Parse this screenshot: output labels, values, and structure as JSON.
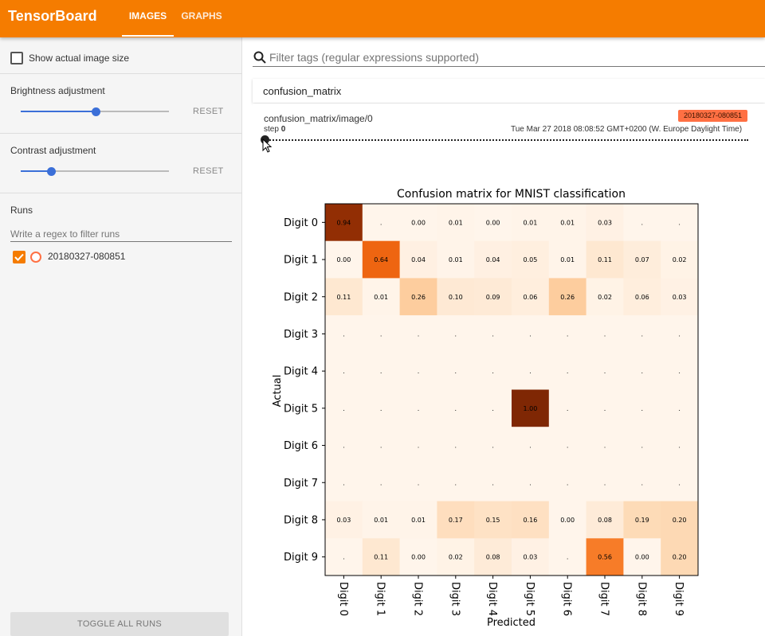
{
  "app": {
    "title": "TensorBoard"
  },
  "nav": {
    "tabs": [
      {
        "label": "IMAGES",
        "active": true
      },
      {
        "label": "GRAPHS",
        "active": false
      }
    ]
  },
  "colors": {
    "accent": "#f57c00",
    "slider": "#3b6fd8",
    "run": "#ff7043"
  },
  "sidebar": {
    "show_actual_size": {
      "label": "Show actual image size",
      "checked": false
    },
    "brightness": {
      "label": "Brightness adjustment",
      "reset": "RESET",
      "level": 0.5
    },
    "contrast": {
      "label": "Contrast adjustment",
      "reset": "RESET",
      "level": 0.2
    },
    "runs": {
      "title": "Runs",
      "filter_placeholder": "Write a regex to filter runs",
      "items": [
        {
          "name": "20180327-080851",
          "checked": true
        }
      ],
      "toggle_all": "TOGGLE ALL RUNS"
    }
  },
  "main": {
    "search_placeholder": "Filter tags (regular expressions supported)",
    "card": {
      "tag": "confusion_matrix",
      "image_tag": "confusion_matrix/image/0",
      "step_label": "step",
      "step_value": "0",
      "run_badge": "20180327-080851",
      "timestamp": "Tue Mar 27 2018 08:08:52 GMT+0200 (W. Europe Daylight Time)"
    }
  },
  "chart_data": {
    "type": "heatmap",
    "title": "Confusion matrix for MNIST classification",
    "xlabel": "Predicted",
    "ylabel": "Actual",
    "rows": [
      "Digit 0",
      "Digit 1",
      "Digit 2",
      "Digit 3",
      "Digit 4",
      "Digit 5",
      "Digit 6",
      "Digit 7",
      "Digit 8",
      "Digit 9"
    ],
    "cols": [
      "Digit 0",
      "Digit 1",
      "Digit 2",
      "Digit 3",
      "Digit 4",
      "Digit 5",
      "Digit 6",
      "Digit 7",
      "Digit 8",
      "Digit 9"
    ],
    "values": [
      [
        "0.94",
        ".",
        "0.00",
        "0.01",
        "0.00",
        "0.01",
        "0.01",
        "0.03",
        ".",
        "."
      ],
      [
        "0.00",
        "0.64",
        "0.04",
        "0.01",
        "0.04",
        "0.05",
        "0.01",
        "0.11",
        "0.07",
        "0.02"
      ],
      [
        "0.11",
        "0.01",
        "0.26",
        "0.10",
        "0.09",
        "0.06",
        "0.26",
        "0.02",
        "0.06",
        "0.03"
      ],
      [
        ".",
        ".",
        ".",
        ".",
        ".",
        ".",
        ".",
        ".",
        ".",
        "."
      ],
      [
        ".",
        ".",
        ".",
        ".",
        ".",
        ".",
        ".",
        ".",
        ".",
        "."
      ],
      [
        ".",
        ".",
        ".",
        ".",
        ".",
        "1.00",
        ".",
        ".",
        ".",
        "."
      ],
      [
        ".",
        ".",
        ".",
        ".",
        ".",
        ".",
        ".",
        ".",
        ".",
        "."
      ],
      [
        ".",
        ".",
        ".",
        ".",
        ".",
        ".",
        ".",
        ".",
        ".",
        "."
      ],
      [
        "0.03",
        "0.01",
        "0.01",
        "0.17",
        "0.15",
        "0.16",
        "0.00",
        "0.08",
        "0.19",
        "0.20"
      ],
      [
        ".",
        "0.11",
        "0.00",
        "0.02",
        "0.08",
        "0.03",
        ".",
        "0.56",
        "0.00",
        "0.20"
      ]
    ],
    "colormap": "Oranges"
  }
}
